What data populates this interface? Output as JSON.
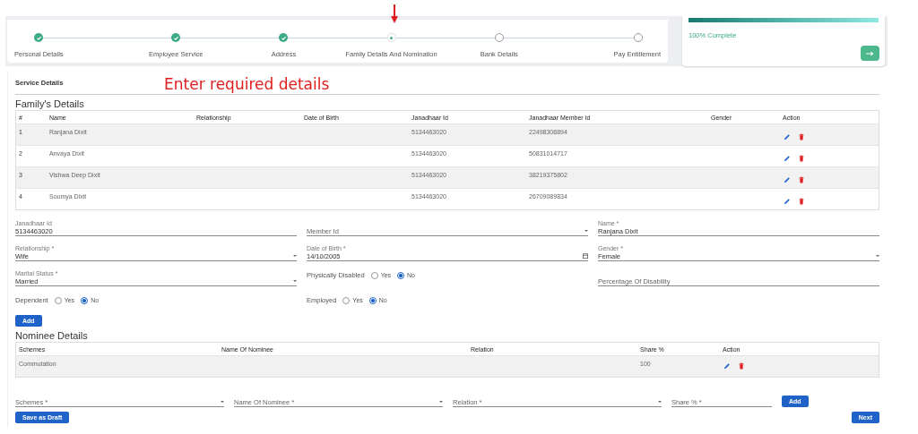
{
  "stepper": {
    "steps": [
      {
        "label": "Personal Details",
        "completed": true,
        "selected": false
      },
      {
        "label": "Employee Service",
        "completed": true,
        "selected": false
      },
      {
        "label": "Address",
        "completed": true,
        "selected": false
      },
      {
        "label": "Family Details And Nomination",
        "completed": false,
        "selected": true
      },
      {
        "label": "Bank Details",
        "completed": false,
        "selected": false
      },
      {
        "label": "Pay Entitlement",
        "completed": false,
        "selected": false
      }
    ]
  },
  "progress": {
    "level": 1,
    "label": "100% Complete"
  },
  "annotation": {
    "text": "Enter required details"
  },
  "section_title": "Service Details",
  "family": {
    "title": "Family's Details",
    "columns": [
      "#",
      "Name",
      "Relationship",
      "Date of Birth",
      "Janadhaar Id",
      "Janadhaar Member Id",
      "Gender",
      "Action"
    ],
    "rows": [
      {
        "no": "1",
        "name": "Ranjana Dixit",
        "janadhaar_id": "5134463020",
        "member_id": "22498308894"
      },
      {
        "no": "2",
        "name": "Anvaya Dixit",
        "janadhaar_id": "5134463020",
        "member_id": "50831014717"
      },
      {
        "no": "3",
        "name": "Vishwa Deep Dixit",
        "janadhaar_id": "5134463020",
        "member_id": "38219375802"
      },
      {
        "no": "4",
        "name": "Soumya Dixit",
        "janadhaar_id": "5134463020",
        "member_id": "26709089834"
      }
    ]
  },
  "form": {
    "fields": [
      {
        "kind": "text",
        "label": "Janadhaar Id",
        "value": "5134463020"
      },
      {
        "kind": "select",
        "placeholder": "Member Id"
      },
      {
        "kind": "text",
        "label": "Name *",
        "value": "Ranjana Dixit"
      },
      {
        "kind": "select",
        "label": "Relationship *",
        "value": "Wife"
      },
      {
        "kind": "date",
        "label": "Date of Birth *",
        "value": "14/10/2005"
      },
      {
        "kind": "select",
        "label": "Gender *",
        "value": "Female"
      },
      {
        "kind": "select",
        "label": "Marital Status *",
        "value": "Married"
      },
      {
        "kind": "radio",
        "label": "Physically Disabled",
        "options": [
          {
            "label": "Yes",
            "selected": false
          },
          {
            "label": "No",
            "selected": true
          }
        ]
      },
      {
        "kind": "text",
        "placeholder": "Percentage Of Disability"
      },
      {
        "kind": "radio",
        "label": "Dependent",
        "options": [
          {
            "label": "Yes",
            "selected": false
          },
          {
            "label": "No",
            "selected": true
          }
        ]
      },
      {
        "kind": "radio",
        "label": "Employed",
        "options": [
          {
            "label": "Yes",
            "selected": false
          },
          {
            "label": "No",
            "selected": true
          }
        ]
      }
    ],
    "add_button": "Add"
  },
  "nominee": {
    "title": "Nominee Details",
    "columns": [
      "Schemes",
      "Name Of Nominee",
      "Relation",
      "Share %",
      "Action"
    ],
    "rows": [
      {
        "scheme": "Commutation",
        "share": "100"
      }
    ],
    "fields": [
      {
        "kind": "select",
        "placeholder": "Schemes *"
      },
      {
        "kind": "select",
        "placeholder": "Name Of Nominee *"
      },
      {
        "kind": "select",
        "placeholder": "Relation *"
      },
      {
        "kind": "text",
        "placeholder": "Share % *"
      }
    ],
    "add_button": "Add"
  },
  "buttons": {
    "draft": "Save as Draft",
    "next": "Next"
  }
}
